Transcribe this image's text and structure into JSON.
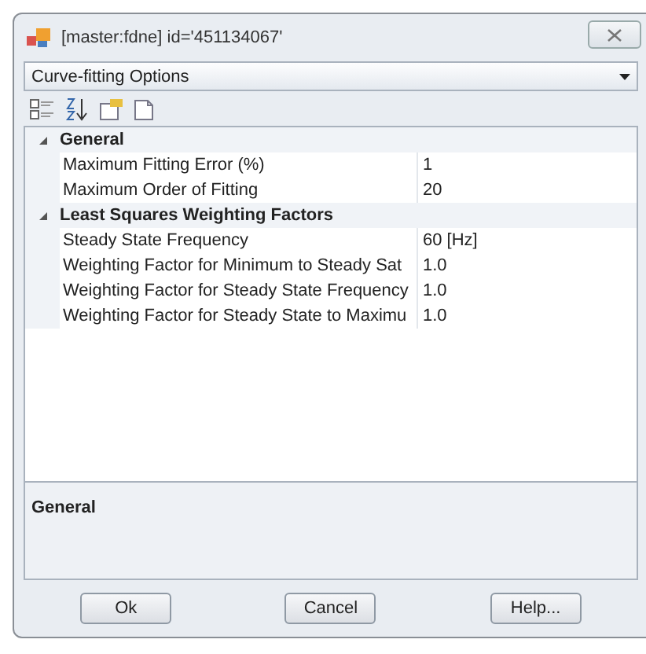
{
  "window": {
    "title": "[master:fdne] id='451134067'"
  },
  "object_selector": {
    "value": "Curve-fitting Options"
  },
  "property_grid": {
    "categories": [
      {
        "name": "General",
        "expanded": true,
        "properties": [
          {
            "name": "Maximum Fitting Error (%)",
            "value": "1"
          },
          {
            "name": "Maximum Order of Fitting",
            "value": "20"
          }
        ]
      },
      {
        "name": "Least Squares Weighting Factors",
        "expanded": true,
        "properties": [
          {
            "name": "Steady State Frequency",
            "value": "60 [Hz]"
          },
          {
            "name": "Weighting Factor for Minimum to Steady Sat",
            "value": "1.0"
          },
          {
            "name": "Weighting Factor for Steady State Frequency",
            "value": "1.0"
          },
          {
            "name": "Weighting Factor for Steady State to Maximu",
            "value": "1.0"
          }
        ]
      }
    ]
  },
  "description": {
    "title": "General"
  },
  "buttons": [
    "Ok",
    "Cancel",
    "Help..."
  ]
}
